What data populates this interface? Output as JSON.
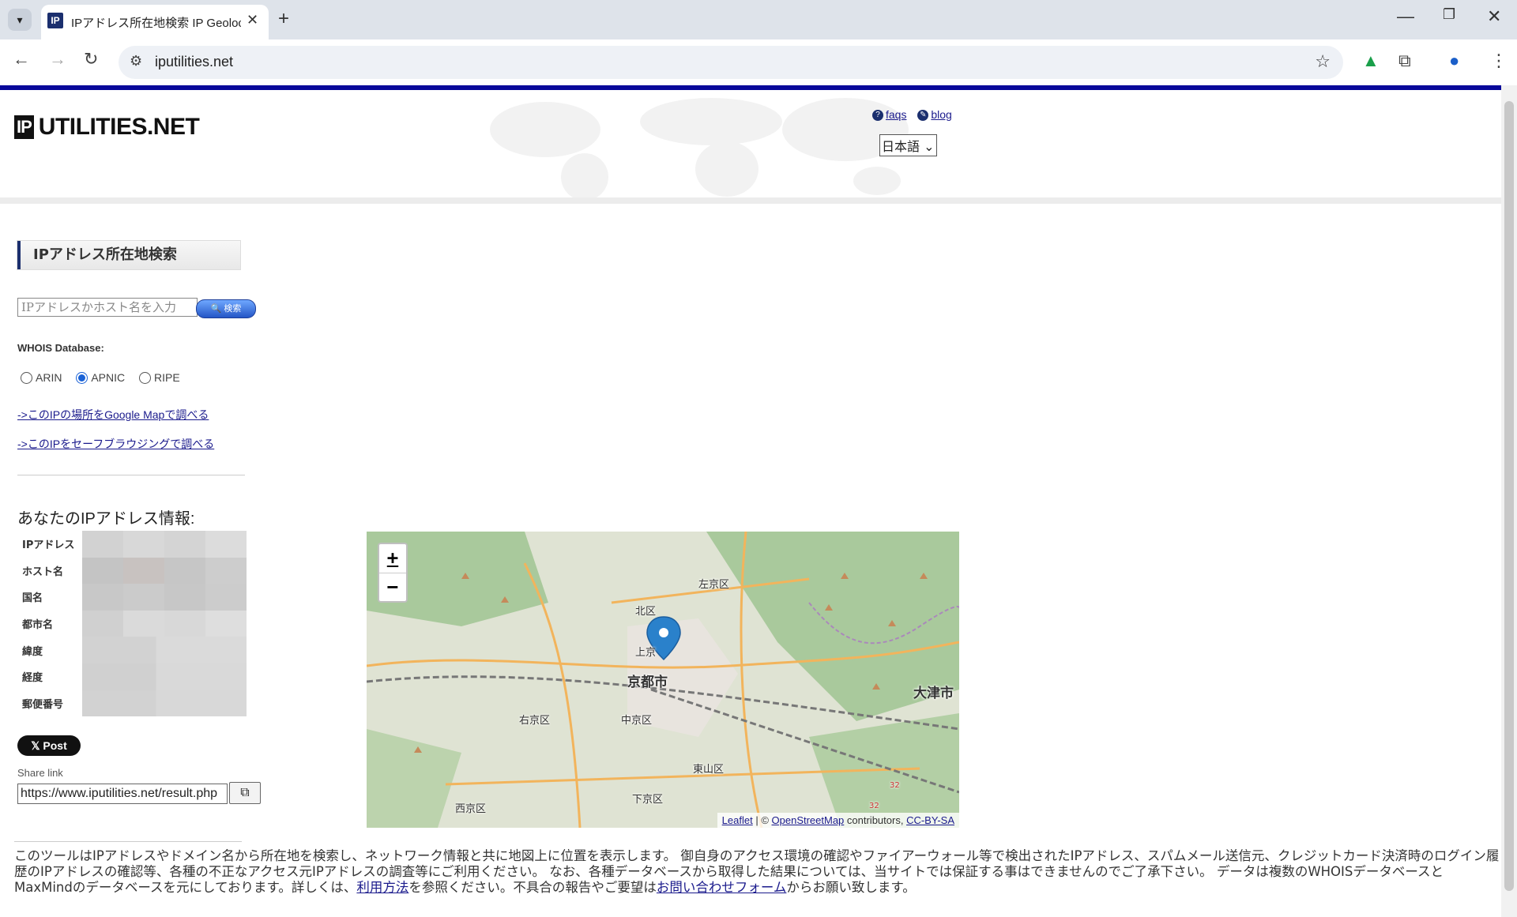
{
  "browser": {
    "tab_title": "IPアドレス所在地検索 IP Geolocation",
    "tab_favicon": "IP",
    "url": "iputilities.net"
  },
  "header": {
    "logo_ip": "IP",
    "logo_text": "UTILITIES.NET",
    "links": [
      {
        "label": "faqs",
        "icon": "question-icon"
      },
      {
        "label": "blog",
        "icon": "blog-icon"
      }
    ],
    "language": "日本語"
  },
  "search": {
    "title": "IPアドレス所在地検索",
    "placeholder": "IPアドレスかホスト名を入力",
    "button_label": "検索",
    "whois_label": "WHOIS Database:",
    "radios": [
      {
        "label": "ARIN",
        "selected": false
      },
      {
        "label": "APNIC",
        "selected": true
      },
      {
        "label": "RIPE",
        "selected": false
      }
    ],
    "link_google": "->このIPの場所をGoogle Mapで調べる",
    "link_safe": "->このIPをセーフブラウジングで調べる"
  },
  "ip_info": {
    "title": "あなたのIPアドレス情報:",
    "rows": [
      "IPアドレス",
      "ホスト名",
      "国名",
      "都市名",
      "緯度",
      "経度",
      "郵便番号"
    ]
  },
  "share": {
    "post_label": "Post",
    "share_label": "Share link",
    "share_url": "https://www.iputilities.net/result.php"
  },
  "map": {
    "zoom_in": "+",
    "zoom_out": "−",
    "labels": [
      "左京区",
      "北区",
      "上京",
      "京都市",
      "右京区",
      "中京区",
      "大津市",
      "東山区",
      "下京区",
      "西京区",
      "32",
      "32"
    ],
    "attribution_leaflet": "Leaflet",
    "attribution_sep": " | © ",
    "attribution_osm": "OpenStreetMap",
    "attribution_contrib": " contributors, ",
    "attribution_license": "CC-BY-SA"
  },
  "footer": {
    "text_1": "このツールはIPアドレスやドメイン名から所在地を検索し、ネットワーク情報と共に地図上に位置を表示します。 御自身のアクセス環境の確認やファイアーウォール等で検出されたIPアドレス、スパムメール送信元、クレジットカード決済時のログイン履歴のIPアドレスの確認等、各種の不正なアクセス元IPアドレスの調査等にご利用ください。 なお、各種データベースから取得した結果については、当サイトでは保証する事はできませんのでご了承下さい。 データは複数のWHOISデータベースとMaxMindのデータベースを元にしております。詳しくは、",
    "link_usage": "利用方法",
    "text_2": "を参照ください。不具合の報告やご要望は",
    "link_contact": "お問い合わせフォーム",
    "text_3": "からお願い致します。"
  },
  "colors": {
    "brand": "#08089a",
    "link": "#1a1a8c",
    "radio_selected": "#1a62d6"
  }
}
